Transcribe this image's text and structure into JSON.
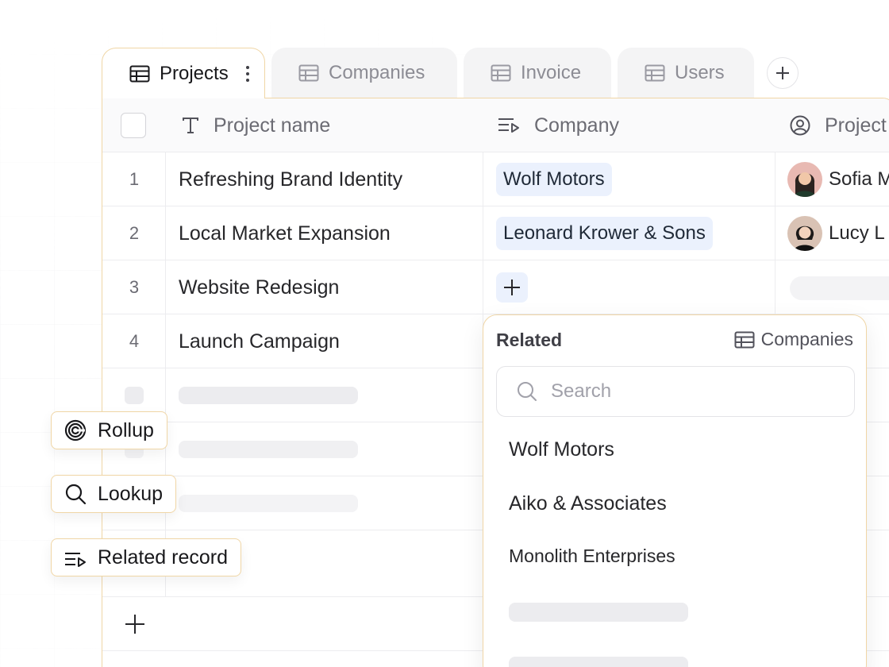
{
  "tabs": [
    {
      "label": "Projects",
      "icon": "table-icon",
      "active": true
    },
    {
      "label": "Companies",
      "icon": "table-icon",
      "active": false
    },
    {
      "label": "Invoice",
      "icon": "table-icon",
      "active": false
    },
    {
      "label": "Users",
      "icon": "table-icon",
      "active": false
    }
  ],
  "add_tab_icon": "plus-icon",
  "columns": [
    {
      "label": "Project name",
      "icon": "text-type-icon"
    },
    {
      "label": "Company",
      "icon": "related-record-icon"
    },
    {
      "label": "Project",
      "icon": "user-circle-icon"
    }
  ],
  "rows": [
    {
      "num": "1",
      "project": "Refreshing Brand Identity",
      "company": "Wolf Motors",
      "person": "Sofia M"
    },
    {
      "num": "2",
      "project": "Local Market Expansion",
      "company": "Leonard Krower & Sons",
      "person": "Lucy L"
    },
    {
      "num": "3",
      "project": "Website Redesign",
      "company": "",
      "person": ""
    },
    {
      "num": "4",
      "project": "Launch Campaign",
      "company": "",
      "person": ""
    }
  ],
  "field_types": [
    {
      "label": "Rollup",
      "icon": "rollup-spiral-icon"
    },
    {
      "label": "Lookup",
      "icon": "search-icon"
    },
    {
      "label": "Related record",
      "icon": "related-record-icon"
    }
  ],
  "popup": {
    "title": "Related",
    "source": "Companies",
    "search_placeholder": "Search",
    "options": [
      "Wolf Motors",
      "Aiko & Associates",
      "Monolith Enterprises"
    ]
  },
  "colors": {
    "accent_border": "#f0d6a6",
    "chip_bg": "#ebf1fd",
    "skeleton": "#ececef"
  }
}
